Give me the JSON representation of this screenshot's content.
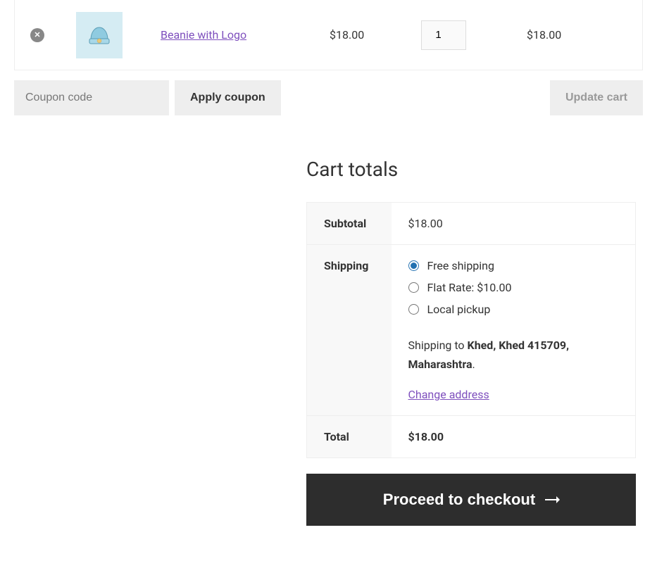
{
  "cart": {
    "items": [
      {
        "name": "Beanie with Logo",
        "price": "$18.00",
        "quantity": "1",
        "subtotal": "$18.00"
      }
    ]
  },
  "coupon": {
    "placeholder": "Coupon code",
    "apply_label": "Apply coupon"
  },
  "update_cart_label": "Update cart",
  "totals": {
    "heading": "Cart totals",
    "subtotal_label": "Subtotal",
    "subtotal_value": "$18.00",
    "shipping_label": "Shipping",
    "shipping_options": [
      {
        "label": "Free shipping",
        "selected": true
      },
      {
        "label": "Flat Rate: $10.00",
        "selected": false
      },
      {
        "label": "Local pickup",
        "selected": false
      }
    ],
    "shipping_to_prefix": "Shipping to ",
    "shipping_to_address": "Khed, Khed 415709, Maharashtra",
    "shipping_to_suffix": ".",
    "change_address_label": "Change address",
    "total_label": "Total",
    "total_value": "$18.00"
  },
  "checkout_label": "Proceed to checkout"
}
